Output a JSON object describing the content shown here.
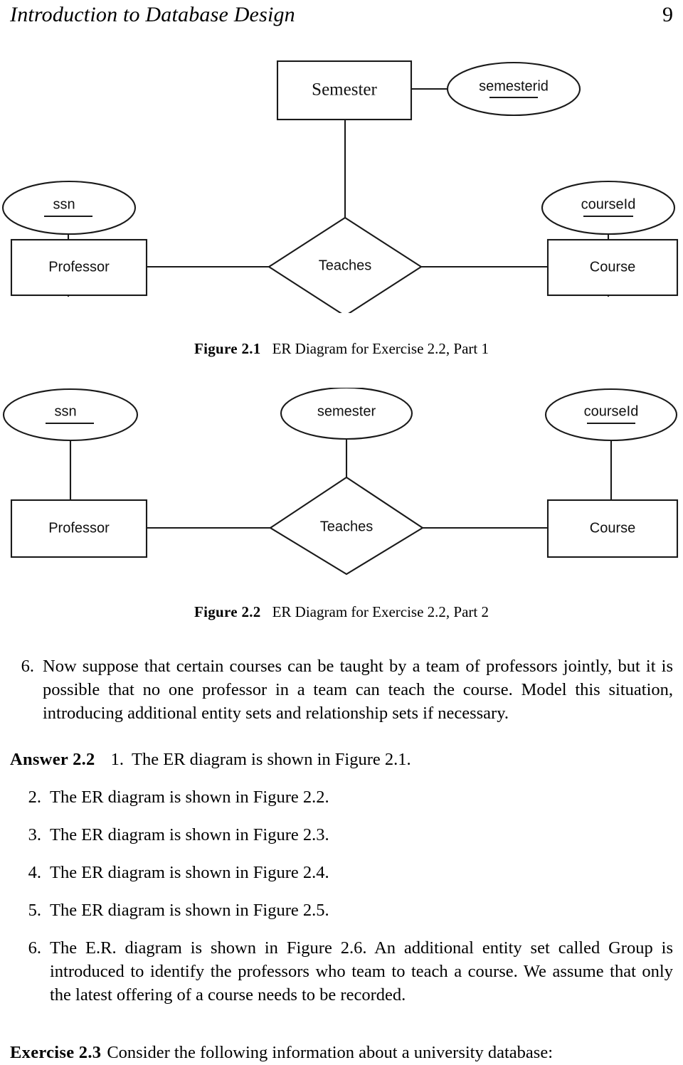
{
  "header": {
    "title": "Introduction to Database Design",
    "page_number": "9"
  },
  "figures": [
    {
      "id": "figure-2-1",
      "caption_number": "Figure 2.1",
      "caption_text": "ER Diagram for Exercise 2.2, Part 1",
      "entities": [
        {
          "name": "Professor",
          "shape": "rectangle"
        },
        {
          "name": "Course",
          "shape": "rectangle"
        },
        {
          "name": "Semester",
          "shape": "rectangle"
        }
      ],
      "relationships": [
        {
          "name": "Teaches",
          "shape": "diamond"
        }
      ],
      "attributes": [
        {
          "name": "ssn",
          "key": true,
          "shape": "ellipse"
        },
        {
          "name": "courseId",
          "key": true,
          "shape": "ellipse"
        },
        {
          "name": "semesterid",
          "key": true,
          "shape": "ellipse"
        }
      ]
    },
    {
      "id": "figure-2-2",
      "caption_number": "Figure 2.2",
      "caption_text": "ER Diagram for Exercise 2.2, Part 2",
      "entities": [
        {
          "name": "Professor",
          "shape": "rectangle"
        },
        {
          "name": "Course",
          "shape": "rectangle"
        }
      ],
      "relationships": [
        {
          "name": "Teaches",
          "shape": "diamond"
        }
      ],
      "attributes": [
        {
          "name": "ssn",
          "key": true,
          "shape": "ellipse"
        },
        {
          "name": "semester",
          "key": false,
          "shape": "ellipse"
        },
        {
          "name": "courseId",
          "key": true,
          "shape": "ellipse"
        }
      ]
    }
  ],
  "question": {
    "marker": "6.",
    "text": "Now suppose that certain courses can be taught by a team of professors jointly, but it is possible that no one professor in a team can teach the course. Model this situation, introducing additional entity sets and relationship sets if necessary."
  },
  "answer": {
    "label": "Answer 2.2",
    "items": [
      {
        "marker": "1.",
        "text": "The ER diagram is shown in Figure 2.1."
      },
      {
        "marker": "2.",
        "text": "The ER diagram is shown in Figure 2.2."
      },
      {
        "marker": "3.",
        "text": "The ER diagram is shown in Figure 2.3."
      },
      {
        "marker": "4.",
        "text": "The ER diagram is shown in Figure 2.4."
      },
      {
        "marker": "5.",
        "text": "The ER diagram is shown in Figure 2.5."
      },
      {
        "marker": "6.",
        "text": "The E.R. diagram is shown in Figure 2.6. An additional entity set called Group is introduced to identify the professors who team to teach a course. We assume that only the latest offering of a course needs to be recorded."
      }
    ]
  },
  "exercise": {
    "label": "Exercise 2.3",
    "text": "Consider the following information about a university database:"
  }
}
